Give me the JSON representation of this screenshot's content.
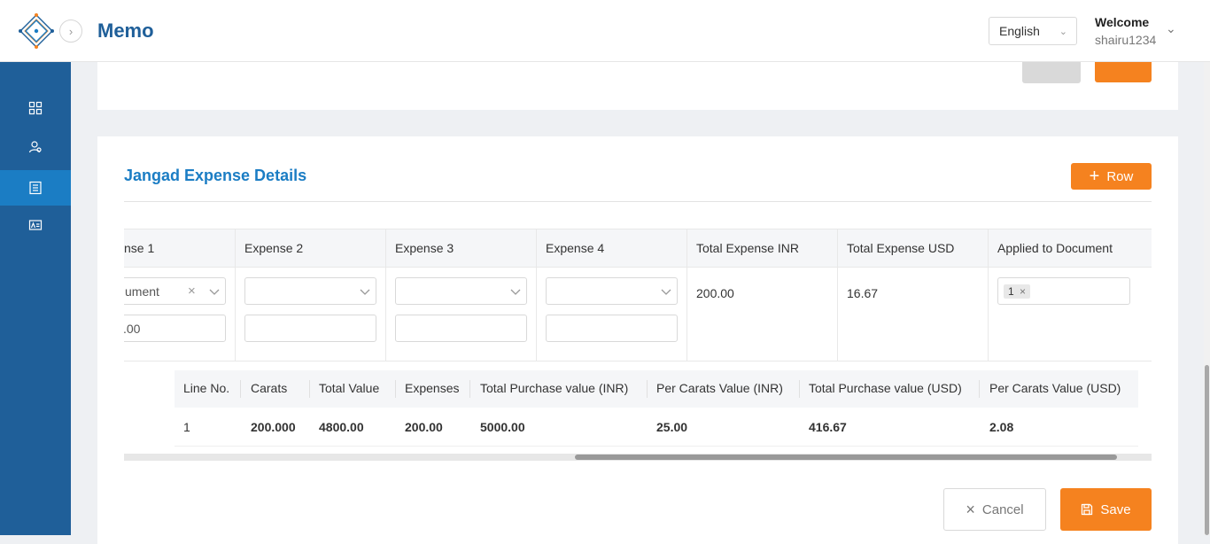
{
  "app": {
    "title": "Memo"
  },
  "header": {
    "language": "English",
    "welcome": "Welcome",
    "username": "shairu1234"
  },
  "section": {
    "title": "Jangad Expense Details",
    "add_row_label": "Row"
  },
  "expense_table": {
    "headers": [
      "nse 1",
      "Expense 2",
      "Expense 3",
      "Expense 4",
      "Total Expense INR",
      "Total Expense USD",
      "Applied to Document"
    ],
    "row": {
      "expense1_select": "ument",
      "expense1_amount": ".00",
      "total_expense_inr": "200.00",
      "total_expense_usd": "16.67",
      "applied_tag": "1"
    }
  },
  "line_table": {
    "headers": [
      "Line No.",
      "Carats",
      "Total Value",
      "Expenses",
      "Total Purchase value (INR)",
      "Per Carats Value (INR)",
      "Total Purchase value (USD)",
      "Per Carats Value (USD)"
    ],
    "rows": [
      [
        "1",
        "200.000",
        "4800.00",
        "200.00",
        "5000.00",
        "25.00",
        "416.67",
        "2.08"
      ]
    ]
  },
  "footer": {
    "cancel_label": "Cancel",
    "save_label": "Save"
  },
  "colors": {
    "primary": "#1f5f99",
    "accent": "#f5821f",
    "active_nav": "#1b7dc4"
  },
  "icons": [
    "app-logo-icon",
    "chevron-right-icon",
    "chevron-down-icon",
    "dashboard-icon",
    "users-icon",
    "list-icon",
    "id-card-icon",
    "plus-icon",
    "clear-icon",
    "trash-icon",
    "close-icon",
    "save-icon"
  ]
}
